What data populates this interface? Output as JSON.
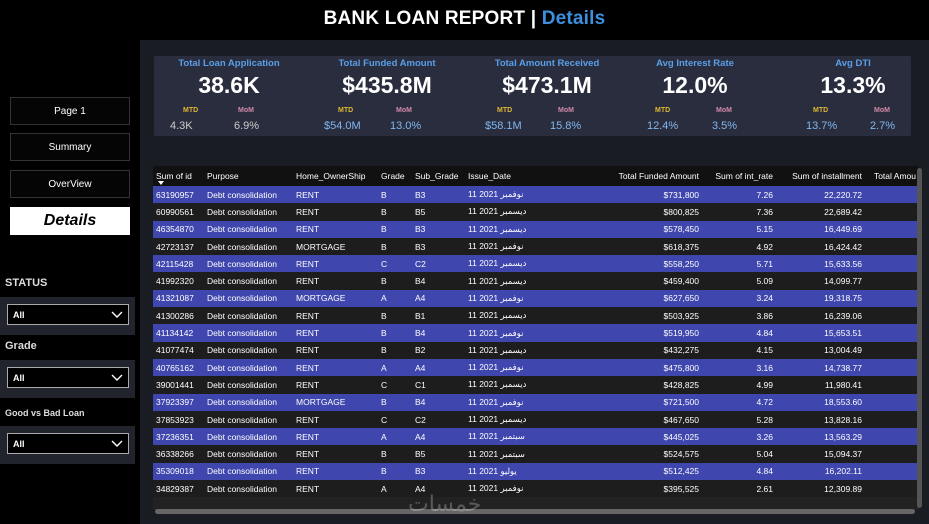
{
  "header": {
    "title_main": "BANK LOAN REPORT | ",
    "title_accent": "Details"
  },
  "sidebar": {
    "nav": [
      {
        "label": "Page 1"
      },
      {
        "label": "Summary"
      },
      {
        "label": "OverView"
      },
      {
        "label": "Details",
        "active": true
      }
    ],
    "filters": [
      {
        "label": "STATUS",
        "value": "All"
      },
      {
        "label": "Grade",
        "value": "All"
      },
      {
        "label": "Good vs Bad Loan",
        "value": "All"
      }
    ]
  },
  "kpis": [
    {
      "title": "Total Loan Application",
      "value": "38.6K",
      "mtd_label": "MTD",
      "mom_label": "MoM",
      "mtd": "4.3K",
      "mom": "6.9%",
      "blue": false
    },
    {
      "title": "Total Funded Amount",
      "value": "$435.8M",
      "mtd_label": "MTD",
      "mom_label": "MoM",
      "mtd": "$54.0M",
      "mom": "13.0%",
      "blue": true
    },
    {
      "title": "Total Amount Received",
      "value": "$473.1M",
      "mtd_label": "MTD",
      "mom_label": "MoM",
      "mtd": "$58.1M",
      "mom": "15.8%",
      "blue": true
    },
    {
      "title": "Avg Interest Rate",
      "value": "12.0%",
      "mtd_label": "MTD",
      "mom_label": "MoM",
      "mtd": "12.4%",
      "mom": "3.5%",
      "blue": true
    },
    {
      "title": "Avg DTI",
      "value": "13.3%",
      "mtd_label": "MTD",
      "mom_label": "MoM",
      "mtd": "13.7%",
      "mom": "2.7%",
      "blue": true
    }
  ],
  "table": {
    "columns": [
      "Sum of id",
      "Purpose",
      "Home_OwnerShip",
      "Grade",
      "Sub_Grade",
      "Issue_Date",
      "Total Funded Amount",
      "Sum of int_rate",
      "Sum of installment",
      "Total Amou"
    ],
    "rows": [
      [
        "63190957",
        "Debt consolidation",
        "RENT",
        "B",
        "B3",
        "نوفمبر 2021 11",
        "$731,800",
        "7.26",
        "22,220.72",
        ""
      ],
      [
        "60990561",
        "Debt consolidation",
        "RENT",
        "B",
        "B5",
        "ديسمبر 2021 11",
        "$800,825",
        "7.36",
        "22,689.42",
        ""
      ],
      [
        "46354870",
        "Debt consolidation",
        "RENT",
        "B",
        "B3",
        "ديسمبر 2021 11",
        "$578,450",
        "5.15",
        "16,449.69",
        ""
      ],
      [
        "42723137",
        "Debt consolidation",
        "MORTGAGE",
        "B",
        "B3",
        "نوفمبر 2021 11",
        "$618,375",
        "4.92",
        "16,424.42",
        ""
      ],
      [
        "42115428",
        "Debt consolidation",
        "RENT",
        "C",
        "C2",
        "ديسمبر 2021 11",
        "$558,250",
        "5.71",
        "15,633.56",
        ""
      ],
      [
        "41992320",
        "Debt consolidation",
        "RENT",
        "B",
        "B4",
        "ديسمبر 2021 11",
        "$459,400",
        "5.09",
        "14,099.77",
        ""
      ],
      [
        "41321087",
        "Debt consolidation",
        "MORTGAGE",
        "A",
        "A4",
        "نوفمبر 2021 11",
        "$627,650",
        "3.24",
        "19,318.75",
        ""
      ],
      [
        "41300286",
        "Debt consolidation",
        "RENT",
        "B",
        "B1",
        "ديسمبر 2021 11",
        "$503,925",
        "3.86",
        "16,239.06",
        ""
      ],
      [
        "41134142",
        "Debt consolidation",
        "RENT",
        "B",
        "B4",
        "نوفمبر 2021 11",
        "$519,950",
        "4.84",
        "15,653.51",
        ""
      ],
      [
        "41077474",
        "Debt consolidation",
        "RENT",
        "B",
        "B2",
        "ديسمبر 2021 11",
        "$432,275",
        "4.15",
        "13,004.49",
        ""
      ],
      [
        "40765162",
        "Debt consolidation",
        "RENT",
        "A",
        "A4",
        "نوفمبر 2021 11",
        "$475,800",
        "3.16",
        "14,738.77",
        ""
      ],
      [
        "39001441",
        "Debt consolidation",
        "RENT",
        "C",
        "C1",
        "ديسمبر 2021 11",
        "$428,825",
        "4.99",
        "11,980.41",
        ""
      ],
      [
        "37923397",
        "Debt consolidation",
        "MORTGAGE",
        "B",
        "B4",
        "نوفمبر 2021 11",
        "$721,500",
        "4.72",
        "18,553.60",
        ""
      ],
      [
        "37853923",
        "Debt consolidation",
        "RENT",
        "C",
        "C2",
        "ديسمبر 2021 11",
        "$467,650",
        "5.28",
        "13,828.16",
        ""
      ],
      [
        "37236351",
        "Debt consolidation",
        "RENT",
        "A",
        "A4",
        "سبتمبر 2021 11",
        "$445,025",
        "3.26",
        "13,563.29",
        ""
      ],
      [
        "36338266",
        "Debt consolidation",
        "RENT",
        "B",
        "B5",
        "سبتمبر 2021 11",
        "$524,575",
        "5.04",
        "15,094.37",
        ""
      ],
      [
        "35309018",
        "Debt consolidation",
        "RENT",
        "B",
        "B3",
        "يوليو 2021 11",
        "$512,425",
        "4.84",
        "16,202.11",
        ""
      ],
      [
        "34829387",
        "Debt consolidation",
        "RENT",
        "A",
        "A4",
        "نوفمبر 2021 11",
        "$395,525",
        "2.61",
        "12,309.89",
        ""
      ]
    ]
  },
  "watermark": "خمسات"
}
